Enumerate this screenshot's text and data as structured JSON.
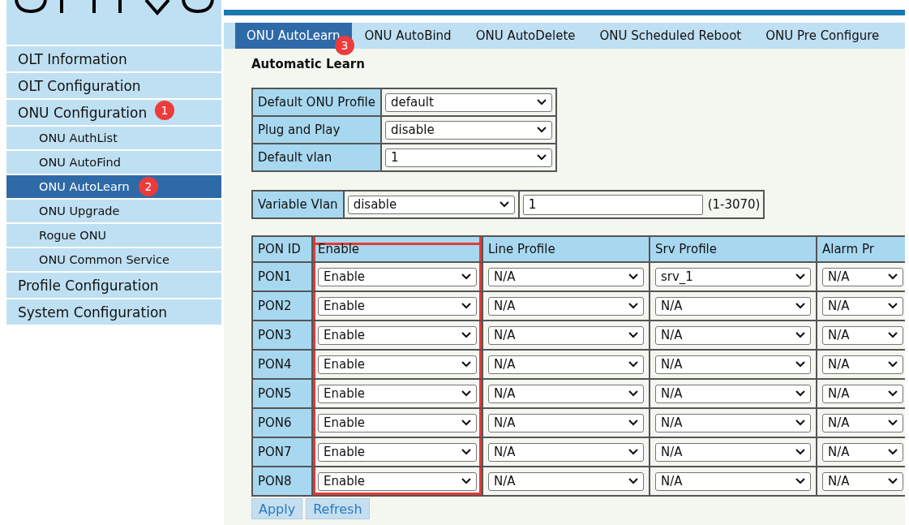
{
  "sidebar": {
    "items": [
      {
        "label": "OLT Information",
        "selected": false
      },
      {
        "label": "OLT Configuration",
        "selected": false
      },
      {
        "label": "ONU Configuration",
        "selected": false,
        "children": [
          {
            "label": "ONU AuthList",
            "selected": false
          },
          {
            "label": "ONU AutoFind",
            "selected": false
          },
          {
            "label": "ONU AutoLearn",
            "selected": true
          },
          {
            "label": "ONU Upgrade",
            "selected": false
          },
          {
            "label": "Rogue ONU",
            "selected": false
          },
          {
            "label": "ONU Common Service",
            "selected": false
          }
        ]
      },
      {
        "label": "Profile Configuration",
        "selected": false
      },
      {
        "label": "System Configuration",
        "selected": false
      }
    ]
  },
  "tabs": [
    {
      "label": "ONU AutoLearn",
      "selected": true
    },
    {
      "label": "ONU AutoBind",
      "selected": false
    },
    {
      "label": "ONU AutoDelete",
      "selected": false
    },
    {
      "label": "ONU Scheduled Reboot",
      "selected": false
    },
    {
      "label": "ONU Pre Configure",
      "selected": false
    }
  ],
  "section_title": "Automatic Learn",
  "defaults": [
    {
      "label": "Default ONU Profile",
      "value": "default"
    },
    {
      "label": "Plug and Play",
      "value": "disable"
    },
    {
      "label": "Default vlan",
      "value": "1"
    }
  ],
  "variable_vlan": {
    "label": "Variable Vlan",
    "value": "disable",
    "number": "1",
    "range": "(1-3070)"
  },
  "table": {
    "columns": [
      {
        "label": "PON ID",
        "highlighted": false
      },
      {
        "label": "Enable",
        "highlighted": true
      },
      {
        "label": "Line Profile",
        "highlighted": false
      },
      {
        "label": "Srv Profile",
        "highlighted": false
      },
      {
        "label": "Alarm Pr",
        "highlighted": false
      }
    ],
    "rows": [
      {
        "pon_id": "PON1",
        "enable": "Enable",
        "line_profile": "N/A",
        "srv_profile": "srv_1",
        "alarm_profile": "N/A"
      },
      {
        "pon_id": "PON2",
        "enable": "Enable",
        "line_profile": "N/A",
        "srv_profile": "N/A",
        "alarm_profile": "N/A"
      },
      {
        "pon_id": "PON3",
        "enable": "Enable",
        "line_profile": "N/A",
        "srv_profile": "N/A",
        "alarm_profile": "N/A"
      },
      {
        "pon_id": "PON4",
        "enable": "Enable",
        "line_profile": "N/A",
        "srv_profile": "N/A",
        "alarm_profile": "N/A"
      },
      {
        "pon_id": "PON5",
        "enable": "Enable",
        "line_profile": "N/A",
        "srv_profile": "N/A",
        "alarm_profile": "N/A"
      },
      {
        "pon_id": "PON6",
        "enable": "Enable",
        "line_profile": "N/A",
        "srv_profile": "N/A",
        "alarm_profile": "N/A"
      },
      {
        "pon_id": "PON7",
        "enable": "Enable",
        "line_profile": "N/A",
        "srv_profile": "N/A",
        "alarm_profile": "N/A"
      },
      {
        "pon_id": "PON8",
        "enable": "Enable",
        "line_profile": "N/A",
        "srv_profile": "N/A",
        "alarm_profile": "N/A"
      }
    ]
  },
  "buttons": [
    "Apply",
    "Refresh"
  ],
  "annotations": [
    {
      "text": "1"
    },
    {
      "text": "2"
    },
    {
      "text": "3"
    }
  ]
}
